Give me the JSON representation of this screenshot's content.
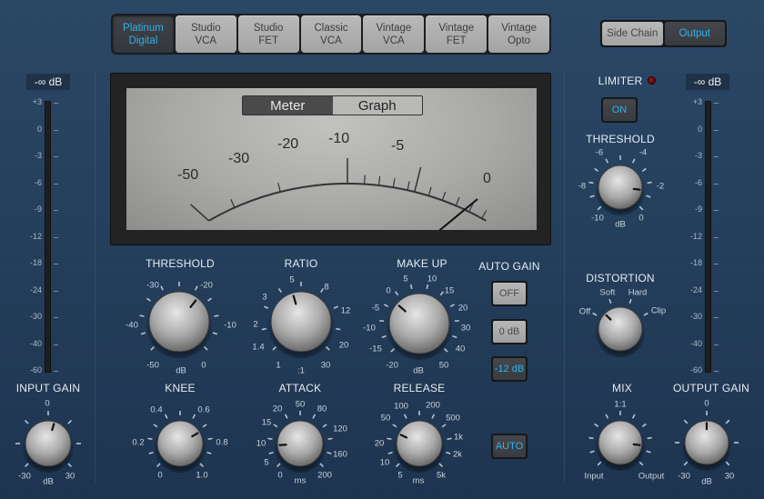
{
  "models": [
    {
      "line1": "Platinum",
      "line2": "Digital",
      "active": true
    },
    {
      "line1": "Studio",
      "line2": "VCA",
      "active": false
    },
    {
      "line1": "Studio",
      "line2": "FET",
      "active": false
    },
    {
      "line1": "Classic",
      "line2": "VCA",
      "active": false
    },
    {
      "line1": "Vintage",
      "line2": "VCA",
      "active": false
    },
    {
      "line1": "Vintage",
      "line2": "FET",
      "active": false
    },
    {
      "line1": "Vintage",
      "line2": "Opto",
      "active": false
    }
  ],
  "view_toggle": {
    "side_chain": "Side Chain",
    "output": "Output",
    "selected": "Output"
  },
  "accent_color": "#2fb2ef",
  "input_meter": {
    "readout": "-∞ dB",
    "scale": [
      "+3",
      "0",
      "-3",
      "-6",
      "-9",
      "-12",
      "-18",
      "-24",
      "-30",
      "-40",
      "-60"
    ]
  },
  "output_meter": {
    "readout": "-∞ dB",
    "scale": [
      "+3",
      "0",
      "-3",
      "-6",
      "-9",
      "-12",
      "-18",
      "-24",
      "-30",
      "-40",
      "-60"
    ]
  },
  "vu_meter": {
    "tabs": {
      "meter": "Meter",
      "graph": "Graph",
      "selected": "Meter"
    },
    "scale": [
      "-50",
      "-30",
      "-20",
      "-10",
      "-5",
      "0"
    ],
    "needle_value_db": 0
  },
  "knobs": {
    "threshold": {
      "title": "THRESHOLD",
      "unit": "dB",
      "labels": [
        "-50",
        "-40",
        "-30",
        "-20",
        "-10",
        "0"
      ],
      "value_fraction": 0.64
    },
    "ratio": {
      "title": "RATIO",
      "unit": ":1",
      "labels": [
        "1",
        "1.4",
        "2",
        "3",
        "5",
        "8",
        "12",
        "20",
        "30"
      ],
      "value_fraction": 0.44
    },
    "make_up": {
      "title": "MAKE UP",
      "unit": "dB",
      "labels": [
        "-20",
        "-15",
        "-10",
        "-5",
        "0",
        "5",
        "10",
        "15",
        "20",
        "30",
        "40",
        "50"
      ],
      "value_fraction": 0.32
    },
    "knee": {
      "title": "KNEE",
      "labels": [
        "0",
        "0.2",
        "0.4",
        "0.6",
        "0.8",
        "1.0"
      ],
      "value_fraction": 0.72
    },
    "attack": {
      "title": "ATTACK",
      "unit": "ms",
      "labels": [
        "0",
        "5",
        "10",
        "15",
        "20",
        "50",
        "80",
        "120",
        "160",
        "200"
      ],
      "value_fraction": 0.15
    },
    "release": {
      "title": "RELEASE",
      "unit": "ms",
      "labels": [
        "5",
        "10",
        "20",
        "50",
        "100",
        "200",
        "500",
        "1k",
        "2k",
        "5k"
      ],
      "value_fraction": 0.26
    },
    "input_gain": {
      "title": "INPUT GAIN",
      "unit": "dB",
      "labels": [
        "-30",
        "0",
        "30"
      ],
      "value_fraction": 0.56
    },
    "limiter_threshold": {
      "title": "THRESHOLD",
      "unit": "dB",
      "labels": [
        "-10",
        "-8",
        "-6",
        "-4",
        "-2",
        "0"
      ],
      "value_fraction": 0.86
    },
    "distortion": {
      "title": "DISTORTION",
      "labels": [
        "Off",
        "Soft",
        "Hard",
        "Clip"
      ],
      "value": "Off"
    },
    "mix": {
      "title": "MIX",
      "labels": [
        "Input",
        "1:1",
        "Output"
      ],
      "value_fraction": 0.86
    },
    "output_gain": {
      "title": "OUTPUT GAIN",
      "unit": "dB",
      "labels": [
        "-30",
        "0",
        "30"
      ],
      "value_fraction": 0.5
    }
  },
  "auto_gain": {
    "title": "AUTO GAIN",
    "options": [
      "OFF",
      "0 dB",
      "-12 dB"
    ],
    "selected": "-12 dB"
  },
  "auto_release": {
    "label": "AUTO",
    "on": true
  },
  "limiter": {
    "title": "LIMITER",
    "on_label": "ON",
    "on": true
  }
}
